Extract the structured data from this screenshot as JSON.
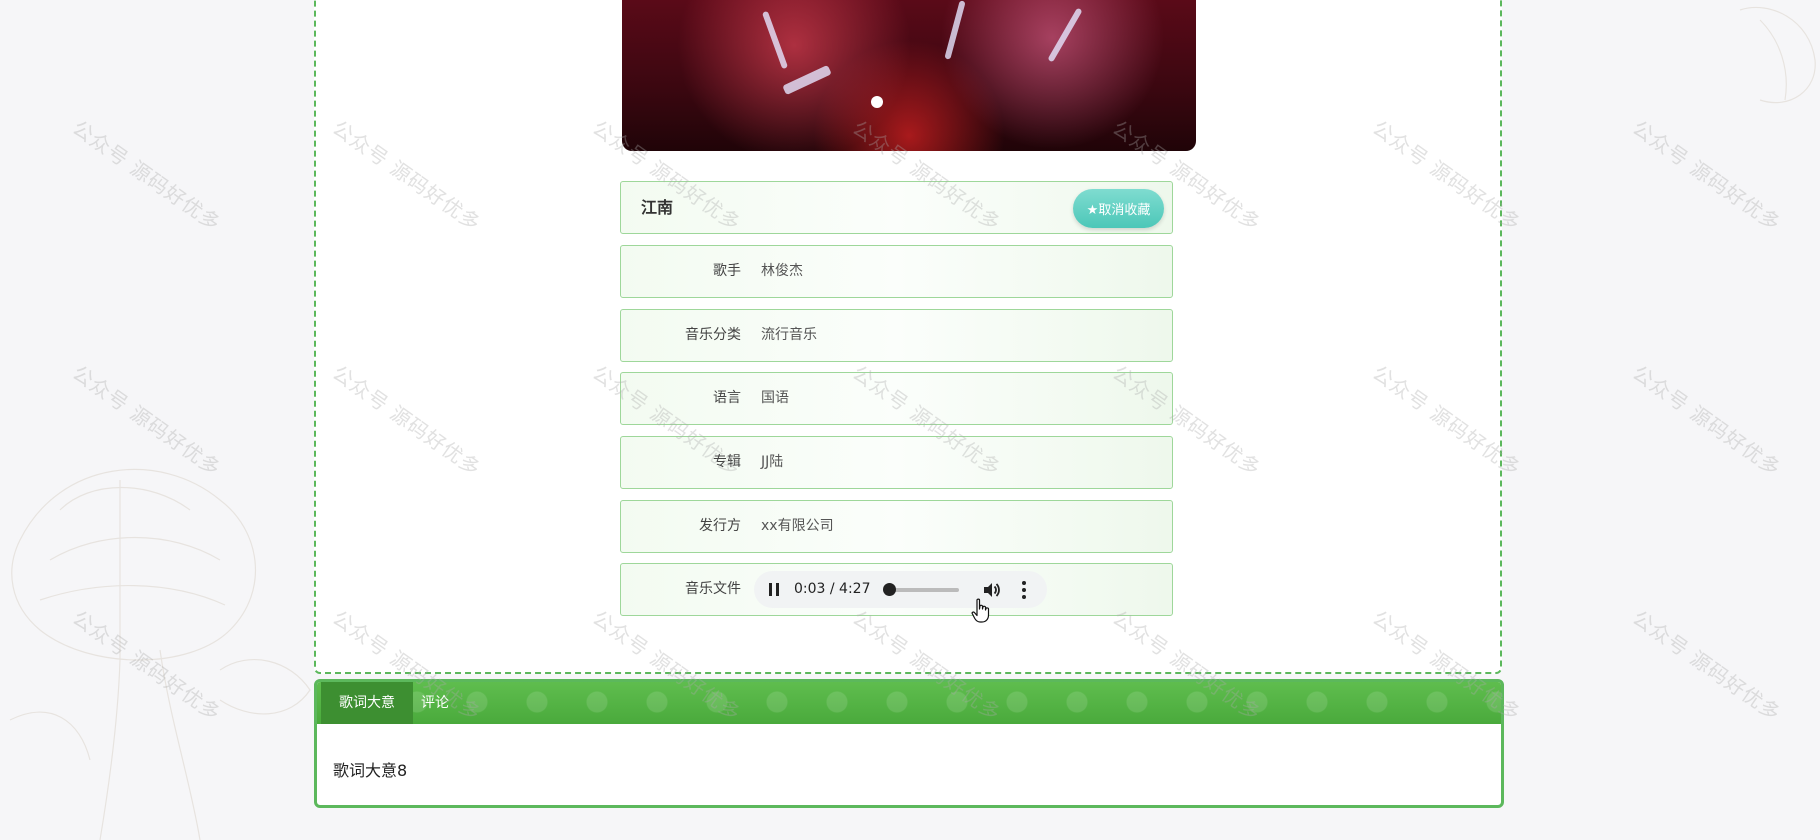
{
  "watermark_text": "公众号 源码好优多",
  "song": {
    "title": "江南",
    "favorite_button": "★取消收藏"
  },
  "fields": [
    {
      "label": "歌手",
      "value": "林俊杰"
    },
    {
      "label": "音乐分类",
      "value": "流行音乐"
    },
    {
      "label": "语言",
      "value": "国语"
    },
    {
      "label": "专辑",
      "value": "JJ陆"
    },
    {
      "label": "发行方",
      "value": "xx有限公司"
    }
  ],
  "audio": {
    "label": "音乐文件",
    "time": "0:03 / 4:27",
    "progress_fraction": 0.011
  },
  "tabs": {
    "items": [
      "歌词大意",
      "评论"
    ],
    "active_index": 0,
    "content": "歌词大意8"
  },
  "colors": {
    "accent_green": "#5cb85c",
    "fav_button": "#4cc7b8"
  }
}
